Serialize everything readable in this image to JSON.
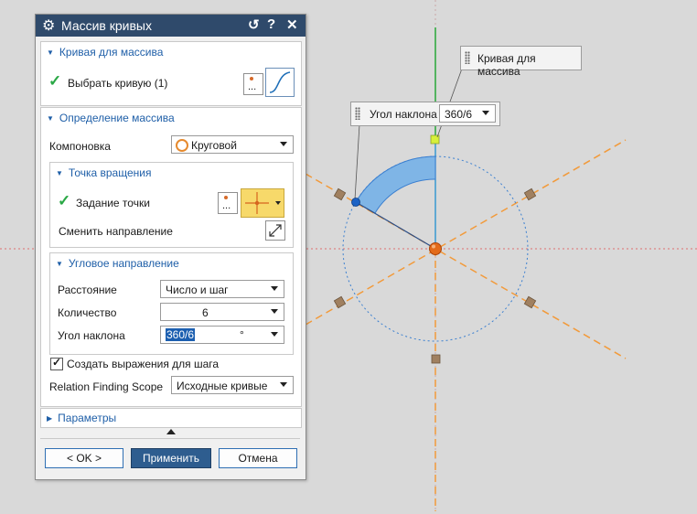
{
  "dialog": {
    "title": "Массив кривых",
    "title_icons": [
      "gear-icon",
      "reset-icon",
      "help-icon",
      "close-icon"
    ],
    "help_label": "?",
    "reset_label": "↺",
    "close_label": "✕",
    "section_curve": {
      "header": "Кривая для массива",
      "select_label": "Выбрать кривую (1)",
      "select_dots": "..."
    },
    "section_definition": {
      "header": "Определение массива",
      "layout_label": "Компоновка",
      "layout_value": "Круговой",
      "rotation_point": {
        "header": "Точка вращения",
        "point_label": "Задание точки",
        "point_dots": "...",
        "flip_label": "Сменить направление"
      },
      "angular": {
        "header": "Угловое направление",
        "distance_label": "Расстояние",
        "distance_value": "Число и шаг",
        "count_label": "Количество",
        "count_value": "6",
        "angle_label": "Угол наклона",
        "angle_value": "360/6",
        "angle_unit": "°"
      },
      "create_expr_label": "Создать выражения для шага",
      "create_expr_checked": true,
      "scope_label": "Relation Finding Scope",
      "scope_value": "Исходные кривые"
    },
    "section_params": {
      "header": "Параметры"
    },
    "buttons": {
      "ok": "< OK >",
      "apply": "Применить",
      "cancel": "Отмена"
    }
  },
  "viewport": {
    "curve_callout": "Кривая для массива",
    "angle_callout_label": "Угол наклона",
    "angle_callout_value": "360/6",
    "colors": {
      "axis_dashed": "#f29a3a",
      "curve_highlight": "#7fb5e6",
      "center_point": "#e36b1a",
      "y_axis": "#27a838",
      "circle": "#3a7fd0"
    }
  }
}
